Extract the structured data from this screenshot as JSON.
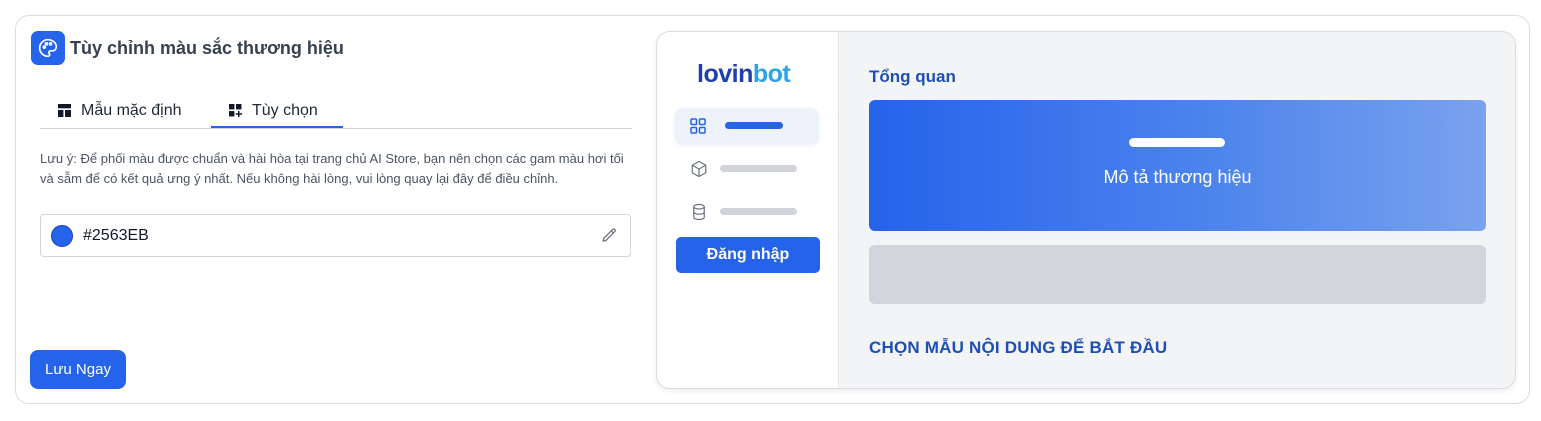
{
  "header": {
    "title": "Tùy chỉnh màu sắc thương hiệu",
    "icon": "palette-icon"
  },
  "tabs": [
    {
      "label": "Mẫu mặc định",
      "icon": "template-icon",
      "active": false
    },
    {
      "label": "Tùy chọn",
      "icon": "add-grid-icon",
      "active": true
    }
  ],
  "note": "Lưu ý: Để phối màu được chuẩn và hài hòa tại trang chủ AI Store, bạn nên chọn các gam màu hơi tối và sẫm để có kết quả ưng ý nhất. Nếu không hài lòng, vui lòng quay lại đây để điều chỉnh.",
  "color_field": {
    "value": "#2563EB",
    "icon": "pencil-icon"
  },
  "save_button": "Lưu Ngay",
  "colors": {
    "brand": "#2563EB"
  },
  "preview": {
    "brand_part1": "lovin",
    "brand_part2": "bot",
    "nav_icons": [
      "grid-icon",
      "box-icon",
      "database-icon"
    ],
    "login_button": "Đăng nhập",
    "overview_title": "Tổng quan",
    "hero_description": "Mô tả thương hiệu",
    "cta": "CHỌN MẪU NỘI DUNG ĐỂ BẮT ĐẦU"
  }
}
